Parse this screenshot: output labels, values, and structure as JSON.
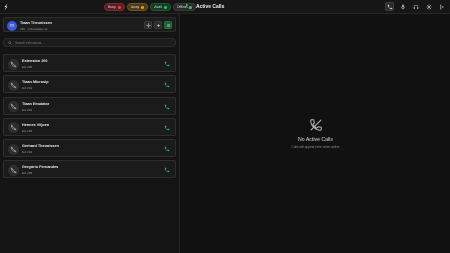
{
  "topbar": {
    "statuses": [
      {
        "label": "Busy",
        "kind": "busy"
      },
      {
        "label": "Away",
        "kind": "away"
      },
      {
        "label": "Avail",
        "kind": "avail"
      },
      {
        "label": "Offline",
        "kind": "offline"
      }
    ],
    "title": "Active Calls",
    "right_icons": [
      "phone-icon",
      "microphone-icon",
      "headset-icon",
      "gear-icon",
      "logout-icon"
    ]
  },
  "user": {
    "initials": "TT",
    "name": "Tiaan Theunissen",
    "subtitle": "256 · onlinestatus ok"
  },
  "search": {
    "placeholder": "Search extensions..."
  },
  "contacts": [
    {
      "name": "Extension 200",
      "ext": "Ext 200"
    },
    {
      "name": "Tiaan Microsip",
      "ext": "Ext 201"
    },
    {
      "name": "Tiaan Emulator",
      "ext": "Ext 202"
    },
    {
      "name": "Hennes Viljoen",
      "ext": "Ext 203"
    },
    {
      "name": "Gerhard Theunissen",
      "ext": "Ext 204"
    },
    {
      "name": "Gregório Fernandes",
      "ext": "Ext 205"
    }
  ],
  "empty_state": {
    "title": "No Active Calls",
    "subtitle": "Calls will appear here when active"
  },
  "colors": {
    "accent_green": "#22c55e",
    "busy": "#ef4444",
    "away": "#f59e0b",
    "offline": "#8a8a8a"
  }
}
